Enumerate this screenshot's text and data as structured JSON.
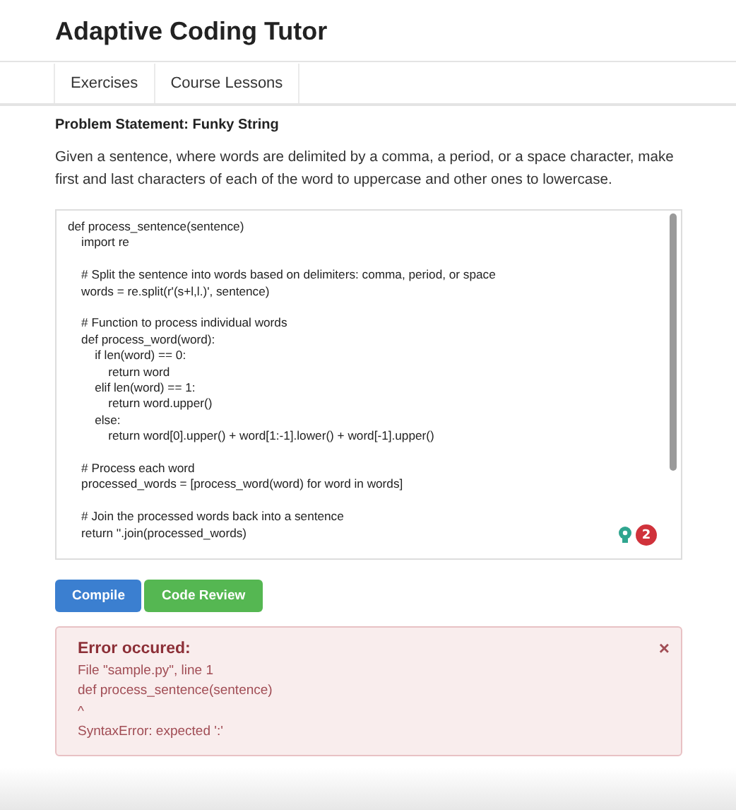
{
  "header": {
    "title": "Adaptive Coding Tutor"
  },
  "nav": {
    "tabs": [
      {
        "label": "Exercises"
      },
      {
        "label": "Course Lessons"
      }
    ]
  },
  "problem": {
    "heading": "Problem Statement: Funky String",
    "description": "Given a sentence, where words are delimited by a comma, a period, or a space character, make first and last characters of each of the word to uppercase and other ones to lowercase."
  },
  "editor": {
    "blocks": [
      [
        "def process_sentence(sentence)",
        "    import re"
      ],
      [
        "    # Split the sentence into words based on delimiters: comma, period, or space",
        "    words = re.split(r'(s+l,l.)', sentence)"
      ],
      [
        "    # Function to process individual words",
        "    def process_word(word):",
        "        if len(word) == 0:",
        "            return word",
        "        elif len(word) == 1:",
        "            return word.upper()",
        "        else:",
        "            return word[0].upper() + word[1:-1].lower() + word[-1].upper()"
      ],
      [
        "    # Process each word",
        "    processed_words = [process_word(word) for word in words]"
      ],
      [
        "    # Join the processed words back into a sentence",
        "    return ''.join(processed_words)"
      ]
    ],
    "issue_count": "2"
  },
  "buttons": [
    {
      "label": "Compile",
      "kind": "primary"
    },
    {
      "label": "Code Review",
      "kind": "success"
    }
  ],
  "error": {
    "title": "Error occured:",
    "close": "×",
    "lines": [
      "File \"sample.py\", line 1",
      "def process_sentence(sentence)",
      "^",
      "SyntaxError: expected ':'"
    ]
  }
}
